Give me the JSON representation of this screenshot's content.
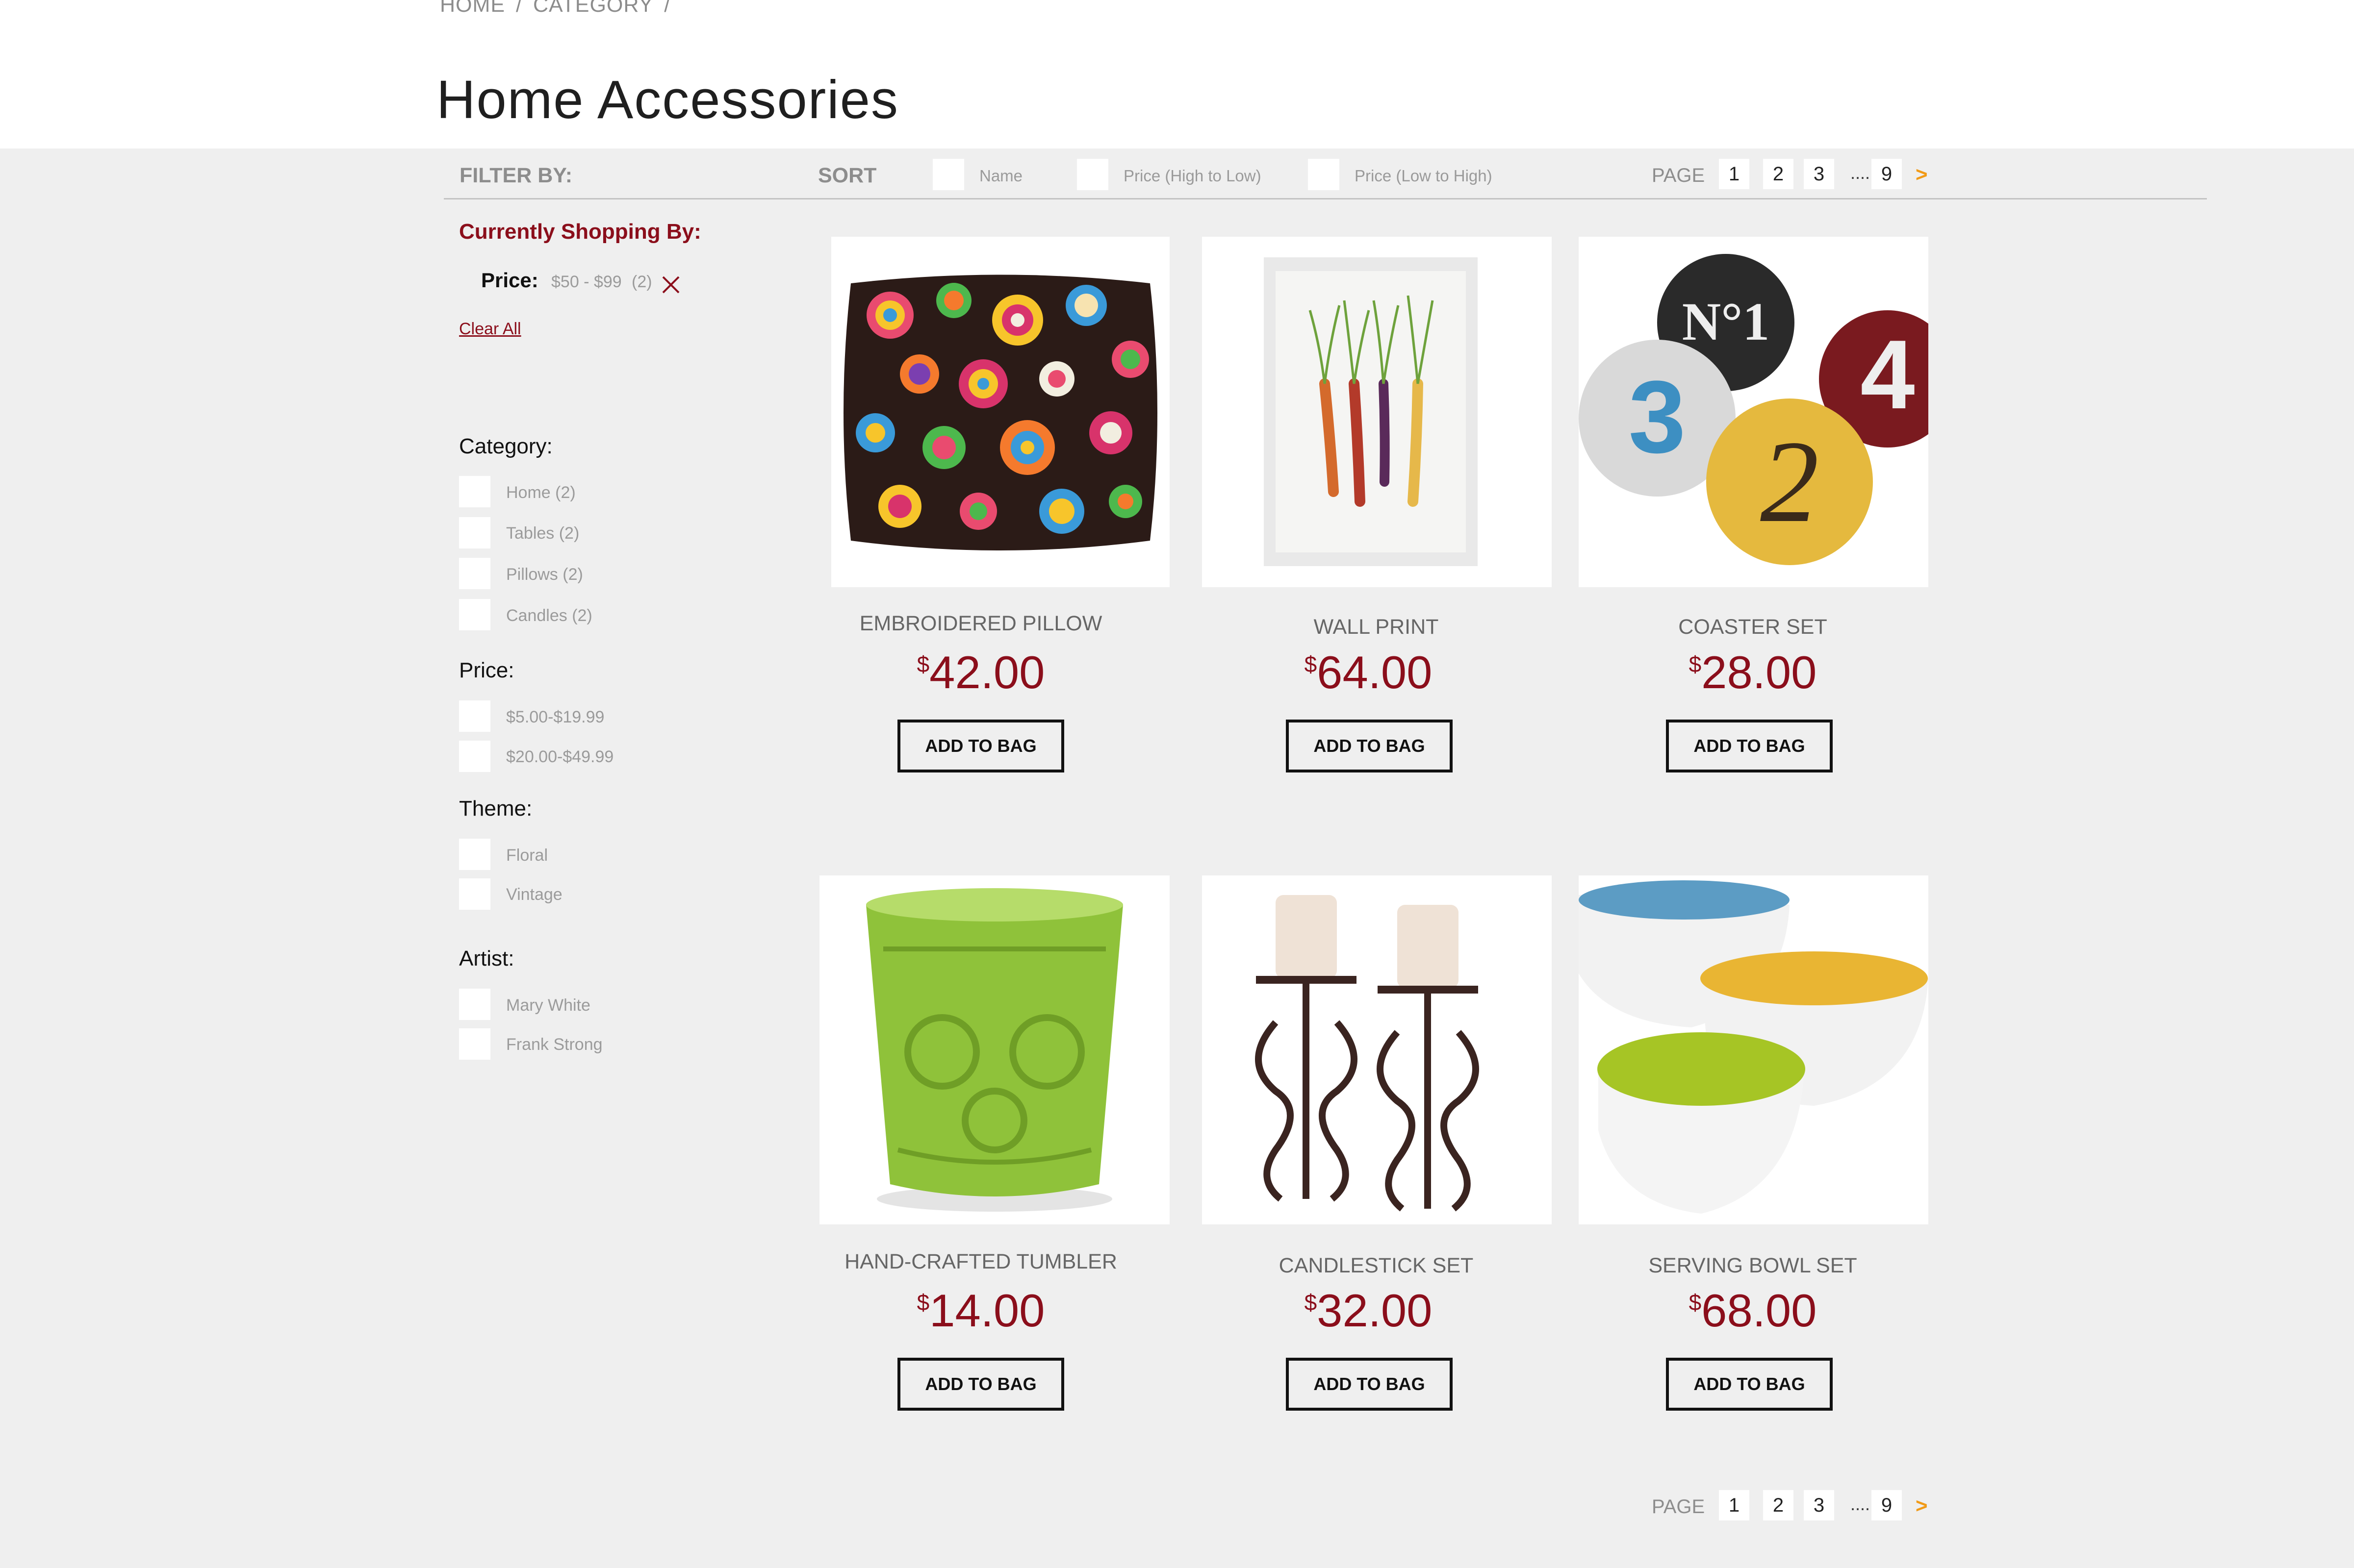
{
  "breadcrumb": [
    "HOME",
    "CATEGORY"
  ],
  "breadcrumb_separator": "/",
  "page_title": "Home Accessories",
  "toolbar": {
    "filter_label": "FILTER BY:",
    "sort_label": "SORT",
    "sort_options": [
      "Name",
      "Price (High to Low)",
      "Price (Low to High)"
    ],
    "page_label": "PAGE",
    "pages": [
      "1",
      "2",
      "3"
    ],
    "pages_dots": "....",
    "pages_last": "9",
    "next": ">"
  },
  "sidebar": {
    "current_heading": "Currently Shopping By:",
    "current_filter": {
      "label": "Price:",
      "value": "$50 - $99",
      "count": "(2)"
    },
    "clear_all": "Clear All",
    "groups": [
      {
        "title": "Category:",
        "options": [
          "Home  (2)",
          "Tables  (2)",
          "Pillows  (2)",
          "Candles (2)"
        ]
      },
      {
        "title": "Price:",
        "options": [
          "$5.00-$19.99",
          "$20.00-$49.99"
        ]
      },
      {
        "title": "Theme:",
        "options": [
          "Floral",
          "Vintage"
        ]
      },
      {
        "title": "Artist:",
        "options": [
          "Mary White",
          "Frank Strong"
        ]
      }
    ]
  },
  "products": [
    {
      "name": "EMBROIDERED PILLOW",
      "currency": "$",
      "price": "42.00",
      "button": "ADD TO BAG",
      "image": "embroidered-pillow-image"
    },
    {
      "name": "WALL PRINT",
      "currency": "$",
      "price": "64.00",
      "button": "ADD TO BAG",
      "image": "wall-print-image"
    },
    {
      "name": "COASTER SET",
      "currency": "$",
      "price": "28.00",
      "button": "ADD TO BAG",
      "image": "coaster-set-image"
    },
    {
      "name": "HAND-CRAFTED TUMBLER",
      "currency": "$",
      "price": "14.00",
      "button": "ADD TO BAG",
      "image": "tumbler-image"
    },
    {
      "name": "CANDLESTICK SET",
      "currency": "$",
      "price": "32.00",
      "button": "ADD TO BAG",
      "image": "candlestick-set-image"
    },
    {
      "name": "SERVING BOWL SET",
      "currency": "$",
      "price": "68.00",
      "button": "ADD TO BAG",
      "image": "serving-bowl-set-image"
    }
  ],
  "colors": {
    "accent": "#8b0e1b",
    "next_arrow": "#f19a16",
    "background": "#efefef",
    "header": "#ffffff"
  }
}
